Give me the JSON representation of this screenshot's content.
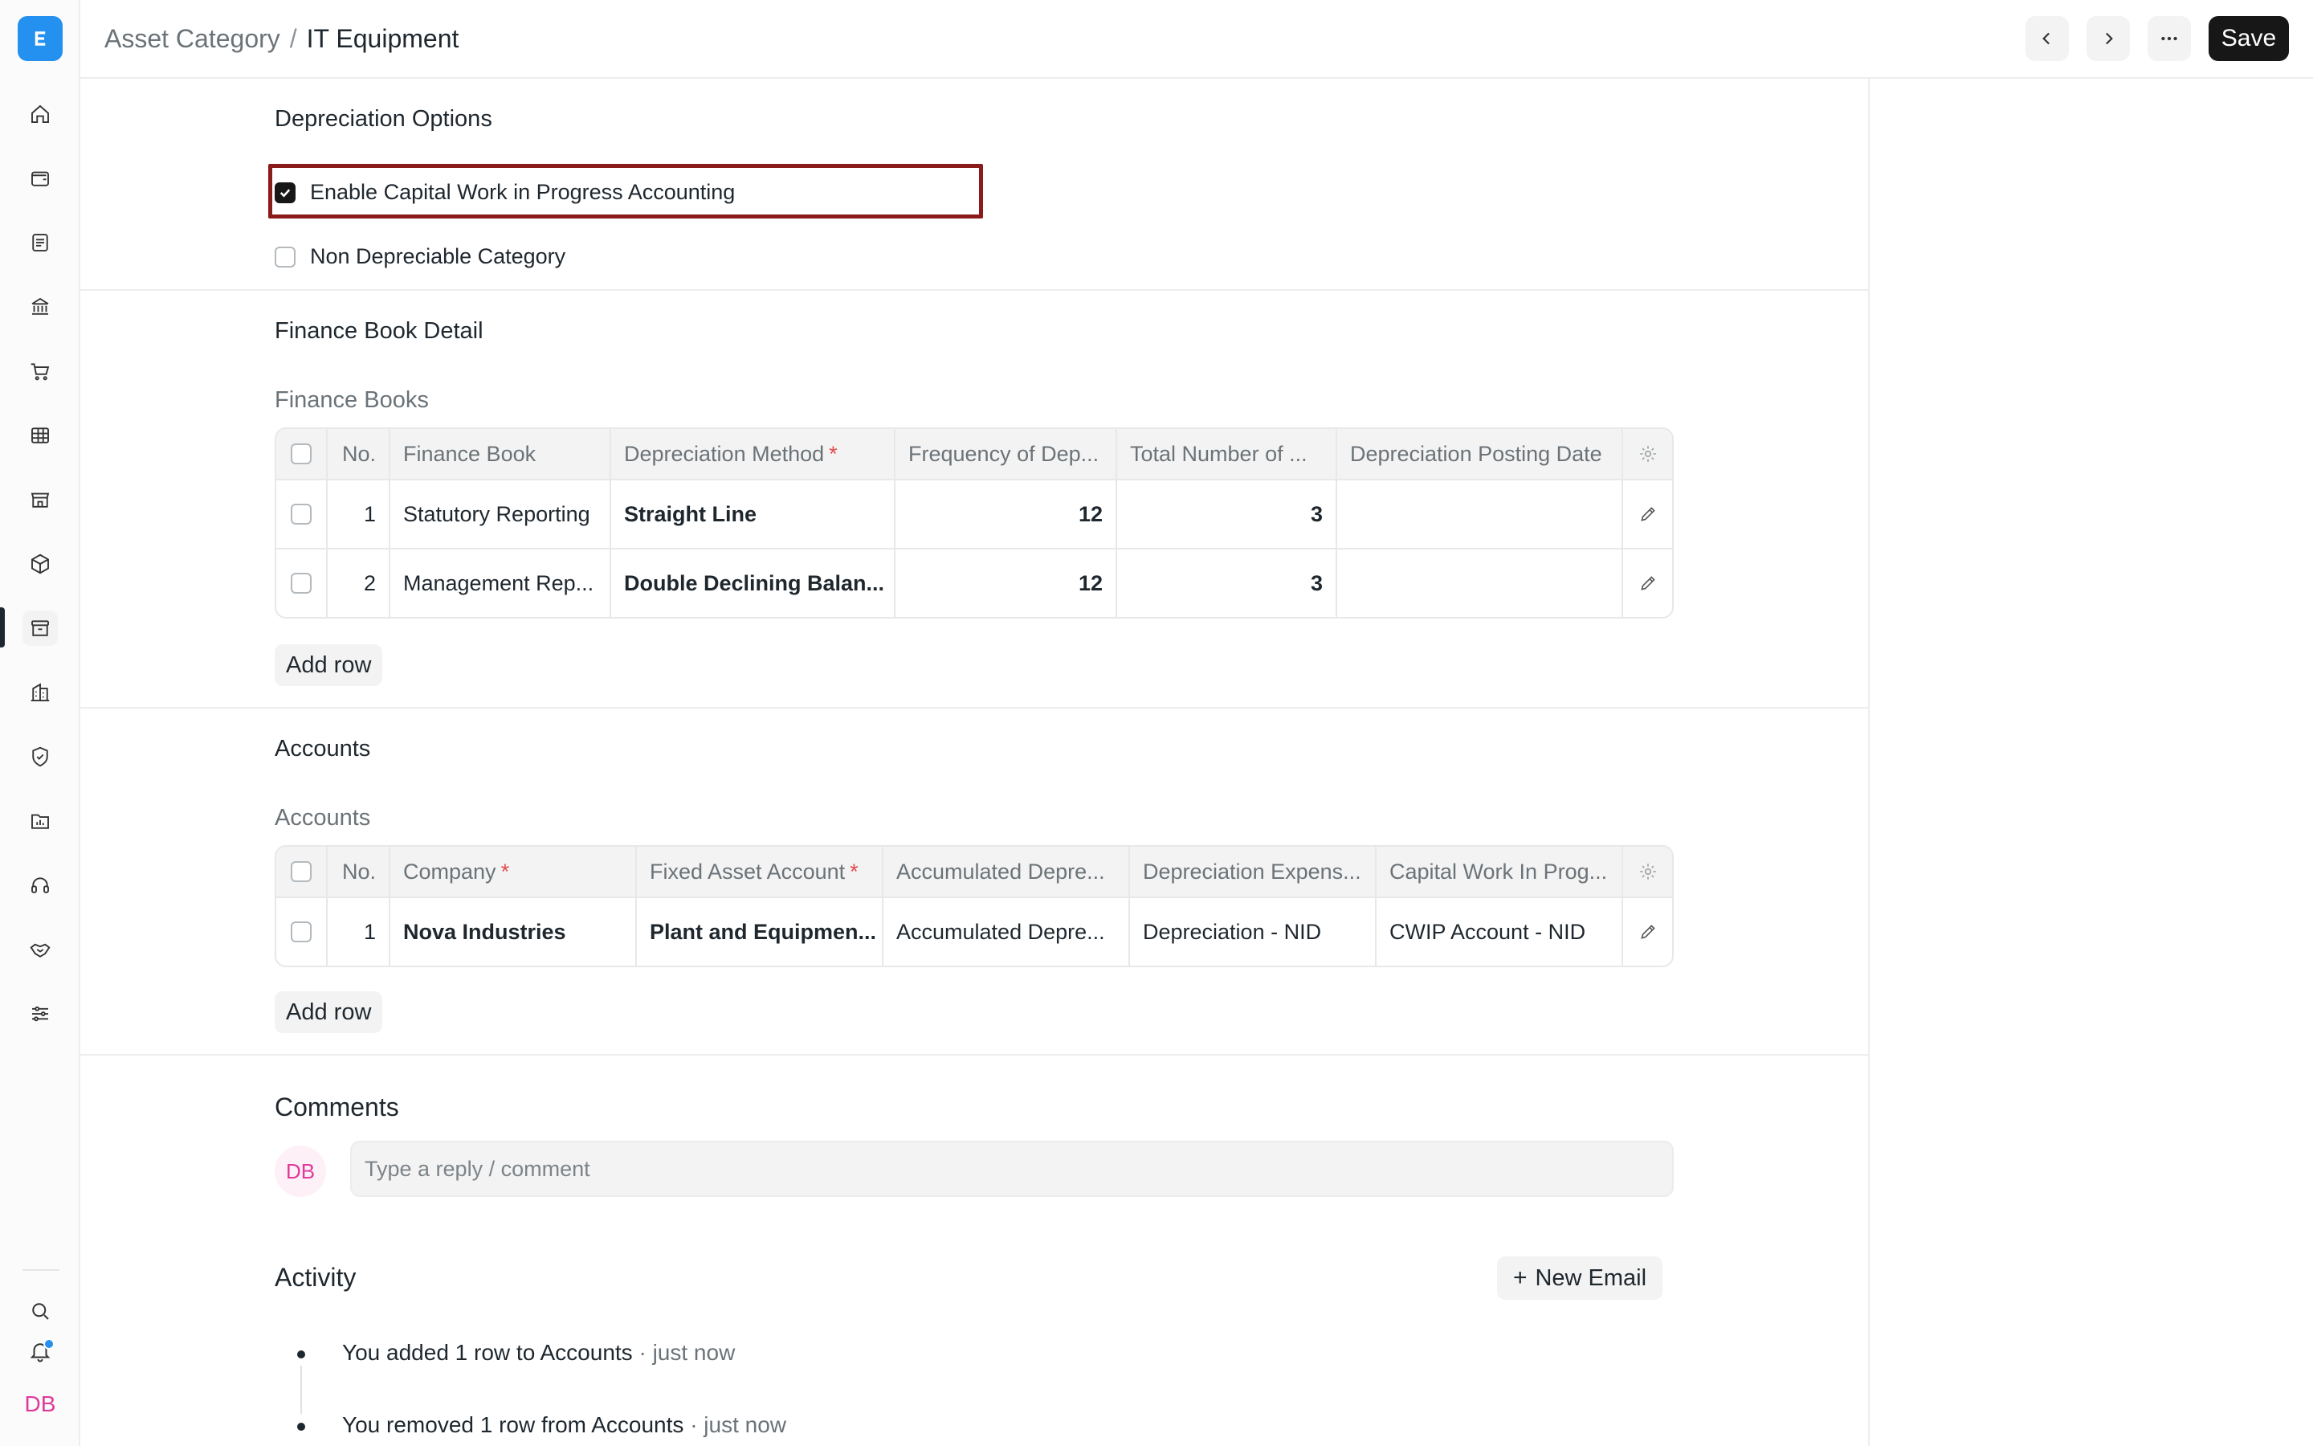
{
  "header": {
    "breadcrumb_parent": "Asset Category",
    "breadcrumb_separator": "/",
    "breadcrumb_current": "IT Equipment",
    "save_label": "Save"
  },
  "sidebar": {
    "icons": [
      "home-icon",
      "wallet-icon",
      "document-icon",
      "bank-icon",
      "cart-icon",
      "table-icon",
      "store-icon",
      "cube-icon",
      "archive-icon",
      "building-icon",
      "shield-icon",
      "folder-chart-icon",
      "headset-icon",
      "handshake-icon",
      "sliders-icon"
    ],
    "active_item": "archive-icon",
    "user_initials": "DB"
  },
  "depreciation_options": {
    "title": "Depreciation Options",
    "enable_cwip_label": "Enable Capital Work in Progress Accounting",
    "enable_cwip_checked": true,
    "non_depreciable_label": "Non Depreciable Category",
    "non_depreciable_checked": false
  },
  "finance_book_detail": {
    "title": "Finance Book Detail",
    "table_label": "Finance Books",
    "columns": [
      "No.",
      "Finance Book",
      "Depreciation Method",
      "Frequency of Dep...",
      "Total Number of ...",
      "Depreciation Posting Date"
    ],
    "rows": [
      {
        "no": "1",
        "finance_book": "Statutory Reporting",
        "method": "Straight Line",
        "frequency": "12",
        "total": "3",
        "posting_date": ""
      },
      {
        "no": "2",
        "finance_book": "Management Rep...",
        "method": "Double Declining Balan...",
        "frequency": "12",
        "total": "3",
        "posting_date": ""
      }
    ],
    "add_row_label": "Add row"
  },
  "accounts": {
    "title": "Accounts",
    "table_label": "Accounts",
    "columns": [
      "No.",
      "Company",
      "Fixed Asset Account",
      "Accumulated Depre...",
      "Depreciation Expens...",
      "Capital Work In Prog..."
    ],
    "rows": [
      {
        "no": "1",
        "company": "Nova Industries",
        "fixed_asset": "Plant and Equipmen...",
        "accumulated": "Accumulated Depre...",
        "expense": "Depreciation - NID",
        "cwip": "CWIP Account - NID"
      }
    ],
    "add_row_label": "Add row"
  },
  "comments": {
    "title": "Comments",
    "avatar_initials": "DB",
    "placeholder": "Type a reply / comment"
  },
  "activity": {
    "title": "Activity",
    "new_email_label": "New Email",
    "items": [
      {
        "text": "You added 1 row to Accounts",
        "time": "· just now"
      },
      {
        "text": "You removed 1 row from Accounts",
        "time": "· just now"
      }
    ]
  },
  "colors": {
    "accent": "#2490ef",
    "highlight_border": "#8b1a1a",
    "required_asterisk": "#e24c4c",
    "avatar_text": "#e0399c"
  }
}
